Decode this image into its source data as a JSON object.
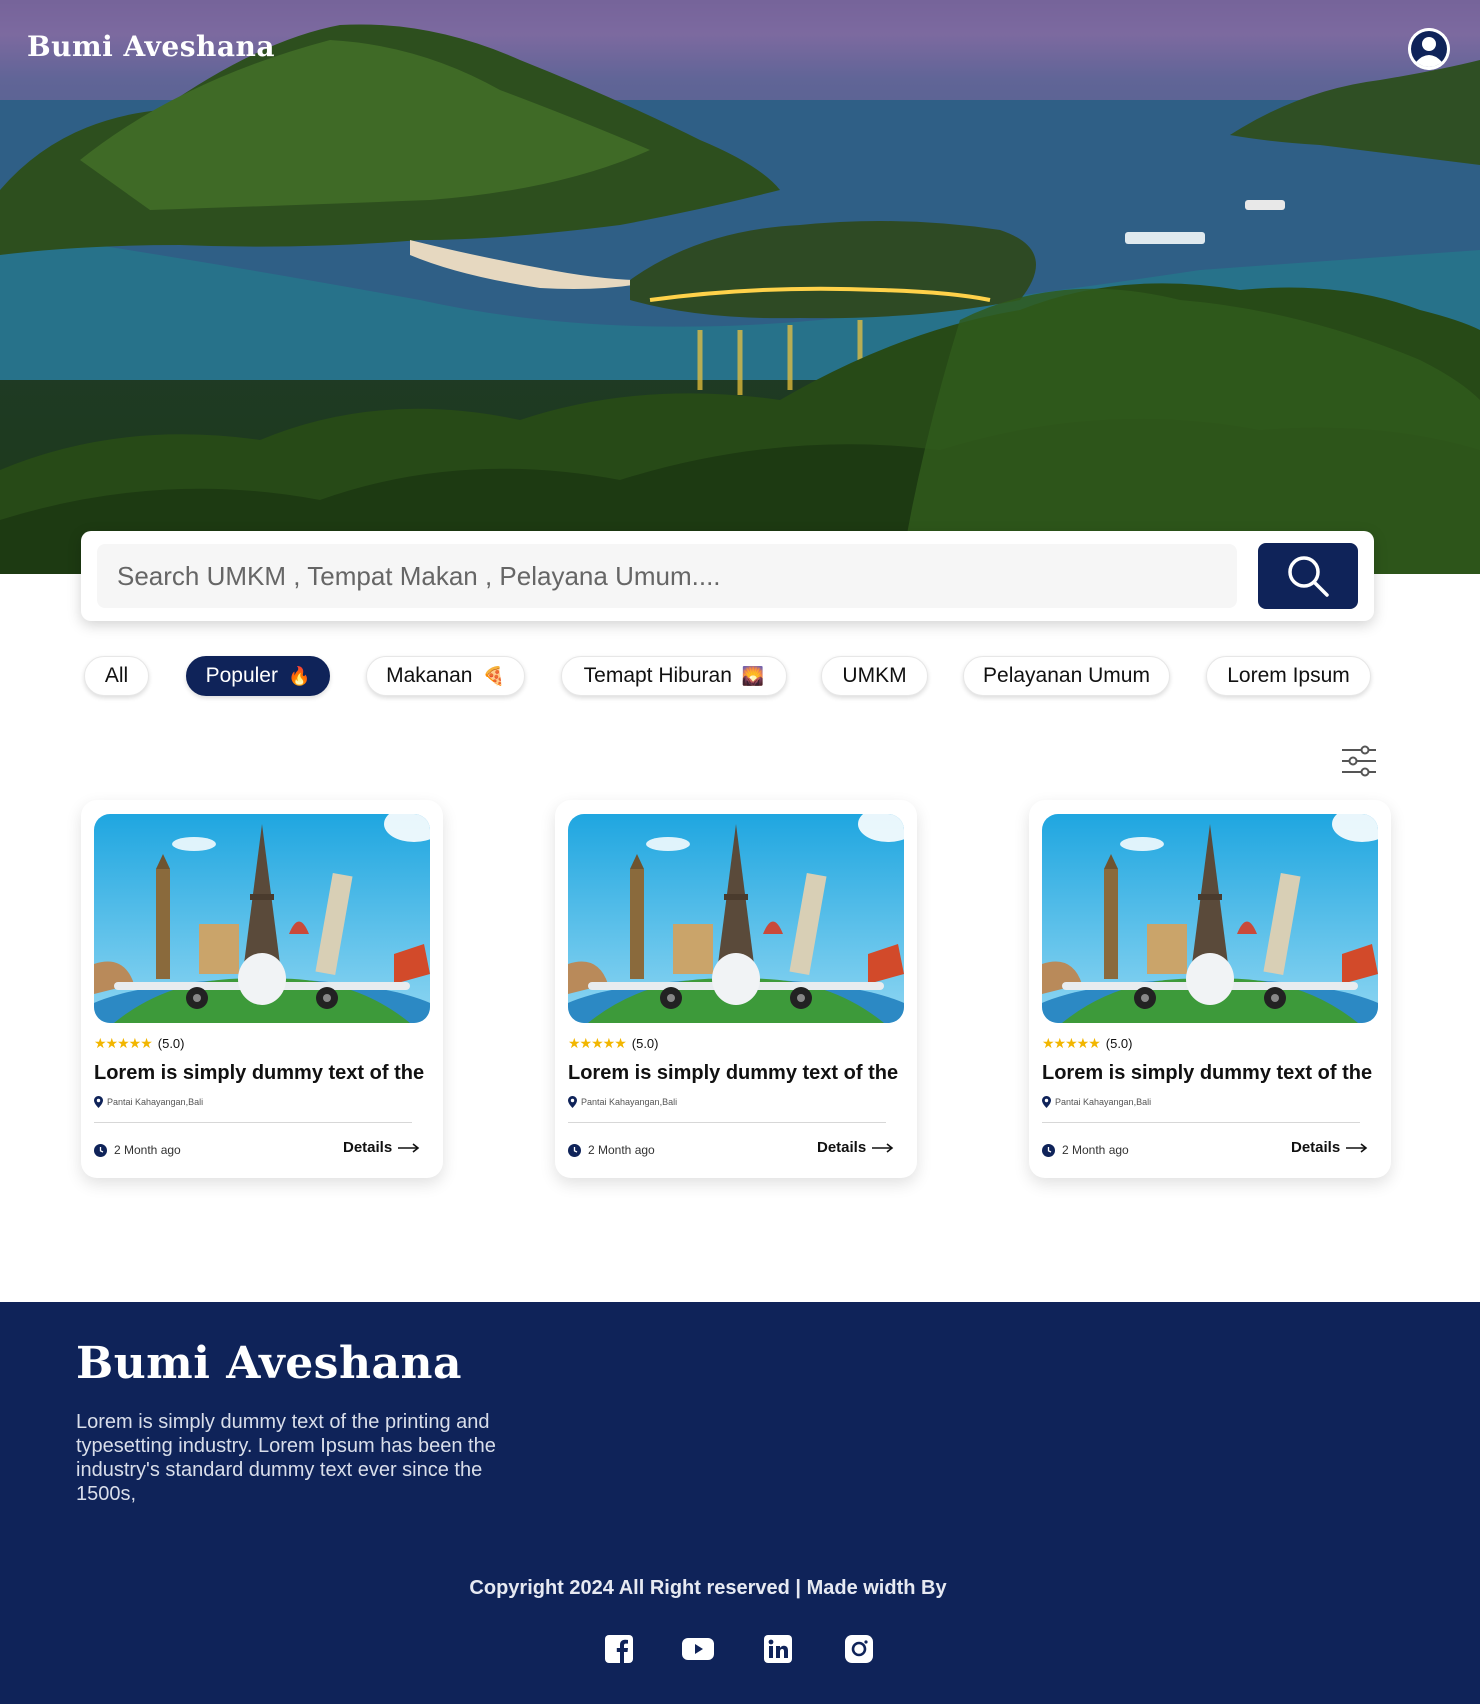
{
  "header": {
    "brand": "Bumi Aveshana"
  },
  "search": {
    "placeholder": "Search UMKM , Tempat Makan , Pelayana Umum...."
  },
  "categories": [
    {
      "label": "All",
      "emoji": "",
      "active": false
    },
    {
      "label": "Populer",
      "emoji": "🔥",
      "active": true
    },
    {
      "label": "Makanan",
      "emoji": "🍕",
      "active": false
    },
    {
      "label": "Temapt Hiburan",
      "emoji": "🌄",
      "active": false
    },
    {
      "label": "UMKM",
      "emoji": "",
      "active": false
    },
    {
      "label": "Pelayanan Umum",
      "emoji": "",
      "active": false
    },
    {
      "label": "Lorem Ipsum",
      "emoji": "",
      "active": false
    }
  ],
  "cards": [
    {
      "rating_stars": "★★★★★",
      "rating": "(5.0)",
      "title": "Lorem is simply dummy text of the",
      "location": "Pantai Kahayangan,Bali",
      "time": "2 Month ago",
      "details": "Details"
    },
    {
      "rating_stars": "★★★★★",
      "rating": "(5.0)",
      "title": "Lorem is simply dummy text of the",
      "location": "Pantai Kahayangan,Bali",
      "time": "2 Month ago",
      "details": "Details"
    },
    {
      "rating_stars": "★★★★★",
      "rating": "(5.0)",
      "title": "Lorem is simply dummy text of the",
      "location": "Pantai Kahayangan,Bali",
      "time": "2 Month ago",
      "details": "Details"
    }
  ],
  "footer": {
    "brand": "Bumi Aveshana",
    "description": "Lorem  is simply dummy text of the printing and typesetting industry. Lorem Ipsum has been the industry's standard dummy text ever since the 1500s,",
    "copyright": "Copyright 2024 All Right reserved | Made width By",
    "social_icons": [
      "facebook-icon",
      "youtube-icon",
      "linkedin-icon",
      "instagram-icon"
    ]
  },
  "colors": {
    "primary": "#0f2359",
    "star": "#f2b600",
    "white": "#ffffff"
  }
}
